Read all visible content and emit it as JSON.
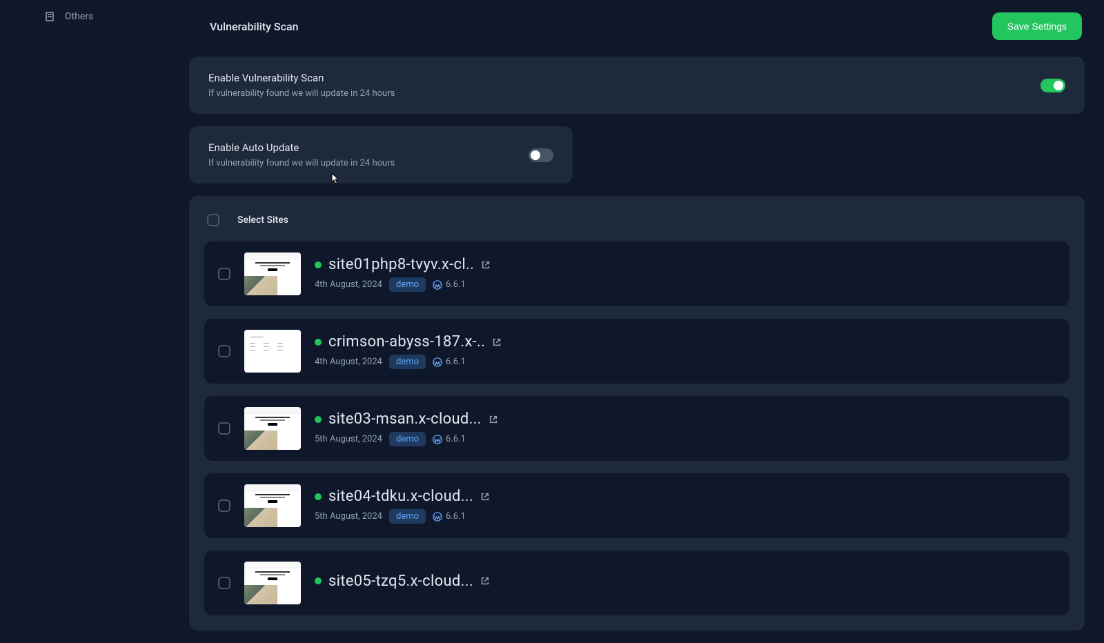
{
  "nav": {
    "others": "Others"
  },
  "page": {
    "title": "Vulnerability Scan",
    "saveButton": "Save Settings"
  },
  "settings": {
    "vulnScan": {
      "label": "Enable Vulnerability Scan",
      "desc": "If vulnerability found we will update in 24 hours",
      "enabled": true
    },
    "autoUpdate": {
      "label": "Enable Auto Update",
      "desc": "If vulnerability found we will update in 24 hours",
      "enabled": false
    }
  },
  "sitesSection": {
    "selectLabel": "Select Sites"
  },
  "sites": [
    {
      "name": "site01php8-tvyv.x-cl..",
      "date": "4th August, 2024",
      "badge": "demo",
      "version": "6.6.1",
      "thumbType": "building"
    },
    {
      "name": "crimson-abyss-187.x-..",
      "date": "4th August, 2024",
      "badge": "demo",
      "version": "6.6.1",
      "thumbType": "minimal"
    },
    {
      "name": "site03-msan.x-cloud...",
      "date": "5th August, 2024",
      "badge": "demo",
      "version": "6.6.1",
      "thumbType": "building"
    },
    {
      "name": "site04-tdku.x-cloud...",
      "date": "5th August, 2024",
      "badge": "demo",
      "version": "6.6.1",
      "thumbType": "building"
    },
    {
      "name": "site05-tzq5.x-cloud...",
      "date": "",
      "badge": "",
      "version": "",
      "thumbType": "building"
    }
  ]
}
